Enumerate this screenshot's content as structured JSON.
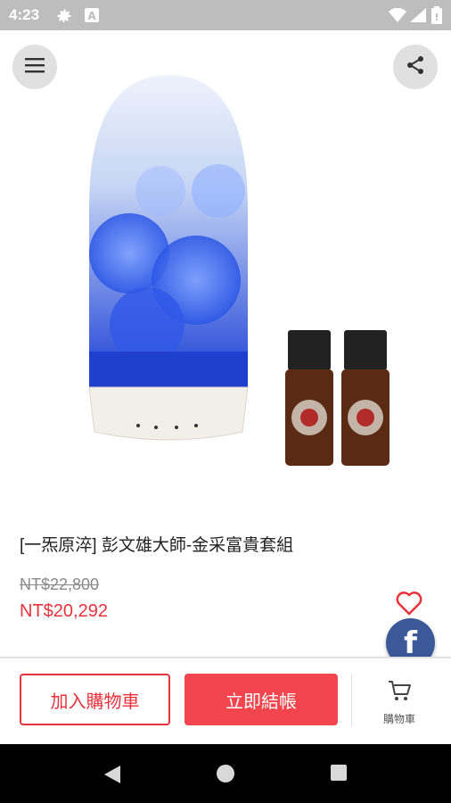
{
  "status_bar": {
    "time": "4:23",
    "icons": [
      "gear-icon",
      "font-a-icon",
      "wifi-icon",
      "signal-icon",
      "battery-icon"
    ]
  },
  "header": {
    "menu_icon": "hamburger-menu-icon",
    "share_icon": "share-icon"
  },
  "product": {
    "title": "[一炁原淬] 彭文雄大師-金采富貴套組",
    "original_price": "NT$22,800",
    "sale_price": "NT$20,292",
    "image_desc_icon": "product-image"
  },
  "colors": {
    "accent_red": "#e8323c",
    "facebook_blue": "#3b5998",
    "status_bar": "#bdbdbd"
  },
  "actions": {
    "add_to_cart": "加入購物車",
    "buy_now": "立即結帳",
    "cart_label": "購物車"
  },
  "nav": {
    "back": "back-icon",
    "home": "home-icon",
    "recents": "recents-icon"
  }
}
